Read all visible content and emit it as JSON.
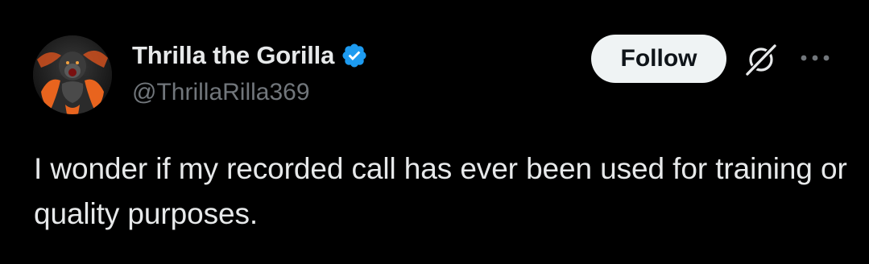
{
  "tweet": {
    "author": {
      "display_name": "Thrilla the Gorilla",
      "handle": "@ThrillaRilla369",
      "verified": true,
      "avatar_icon": "gorilla-avatar"
    },
    "actions": {
      "follow_label": "Follow",
      "grok_icon": "grok-icon",
      "more_icon": "more-options-icon"
    },
    "text": "I wonder if my recorded call has ever been used for training or quality purposes."
  },
  "colors": {
    "background": "#000000",
    "primary_text": "#e7e9ea",
    "secondary_text": "#71767b",
    "verified_blue": "#1d9bf0",
    "follow_bg": "#eff3f4",
    "follow_text": "#0f1419"
  }
}
